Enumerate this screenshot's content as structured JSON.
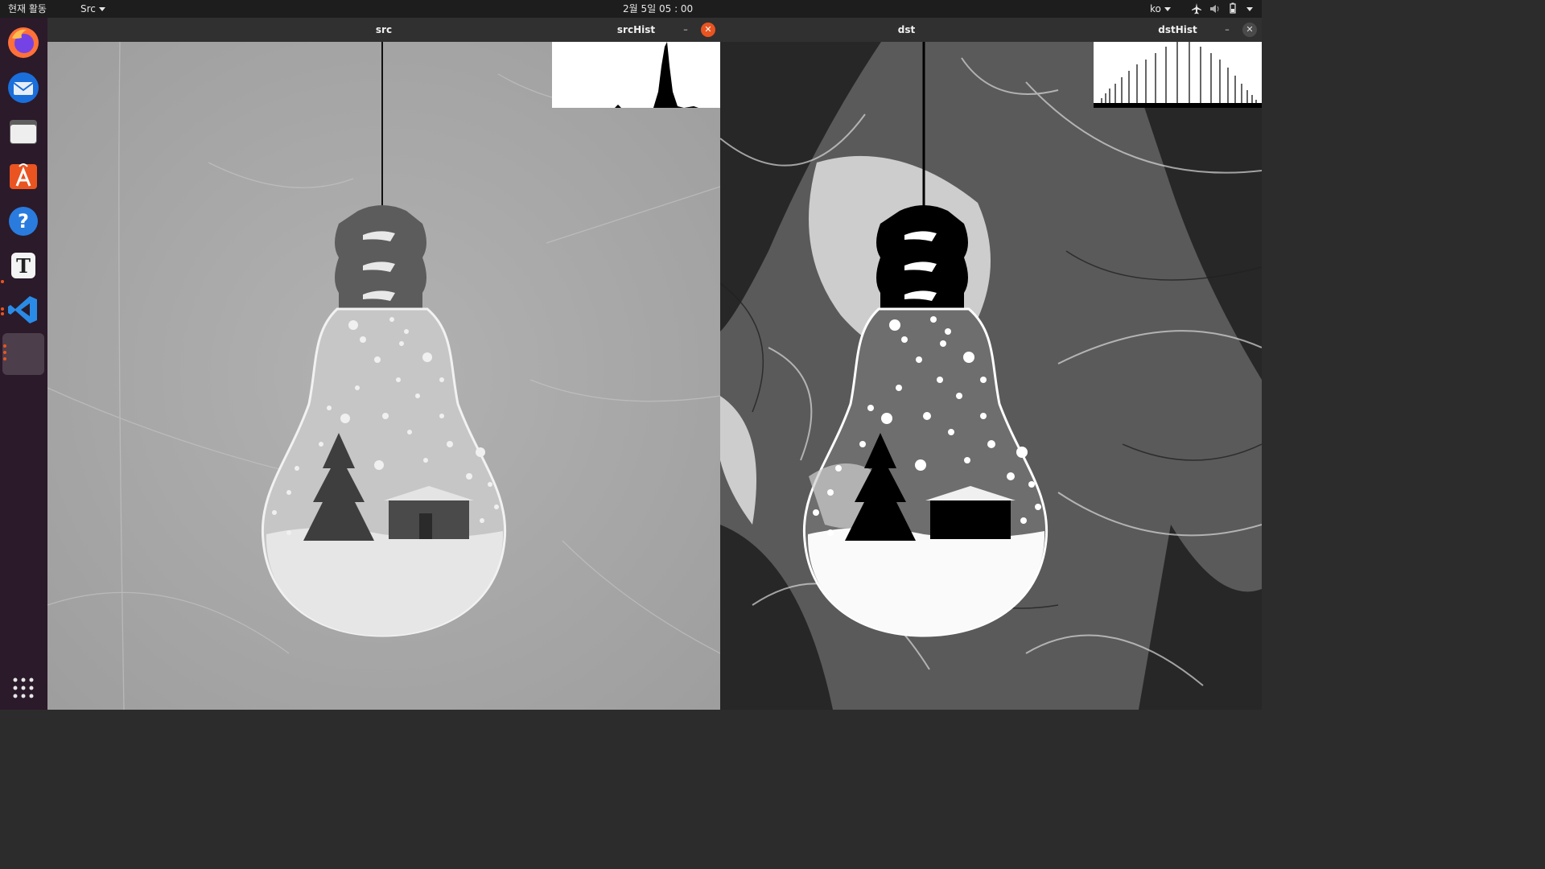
{
  "topbar": {
    "activities": "현재 활동",
    "app_menu": "Src",
    "clock": "2월 5일  05 : 00",
    "language": "ko"
  },
  "dock": {
    "items": [
      {
        "name": "firefox",
        "icon": "firefox-icon"
      },
      {
        "name": "thunderbird",
        "icon": "mail-icon"
      },
      {
        "name": "files",
        "icon": "folder-icon"
      },
      {
        "name": "software",
        "icon": "app-store-icon"
      },
      {
        "name": "help",
        "icon": "help-icon",
        "glyph": "?"
      },
      {
        "name": "typora",
        "icon": "text-editor-icon",
        "glyph": "T"
      },
      {
        "name": "vscode",
        "icon": "vscode-icon"
      },
      {
        "name": "opencv-app",
        "icon": "app-window-icon"
      }
    ],
    "show_apps_icon": "grid-icon"
  },
  "windows": {
    "src": {
      "title": "src"
    },
    "srcHist": {
      "title": "srcHist",
      "minimize": "–",
      "close": "✕"
    },
    "dst": {
      "title": "dst"
    },
    "dstHist": {
      "title": "dstHist",
      "minimize": "–",
      "close": "✕"
    }
  },
  "colors": {
    "accent": "#e95420",
    "topbar": "#1d1d1d",
    "dock": "#2b1a2a",
    "titlebar": "#303030"
  }
}
